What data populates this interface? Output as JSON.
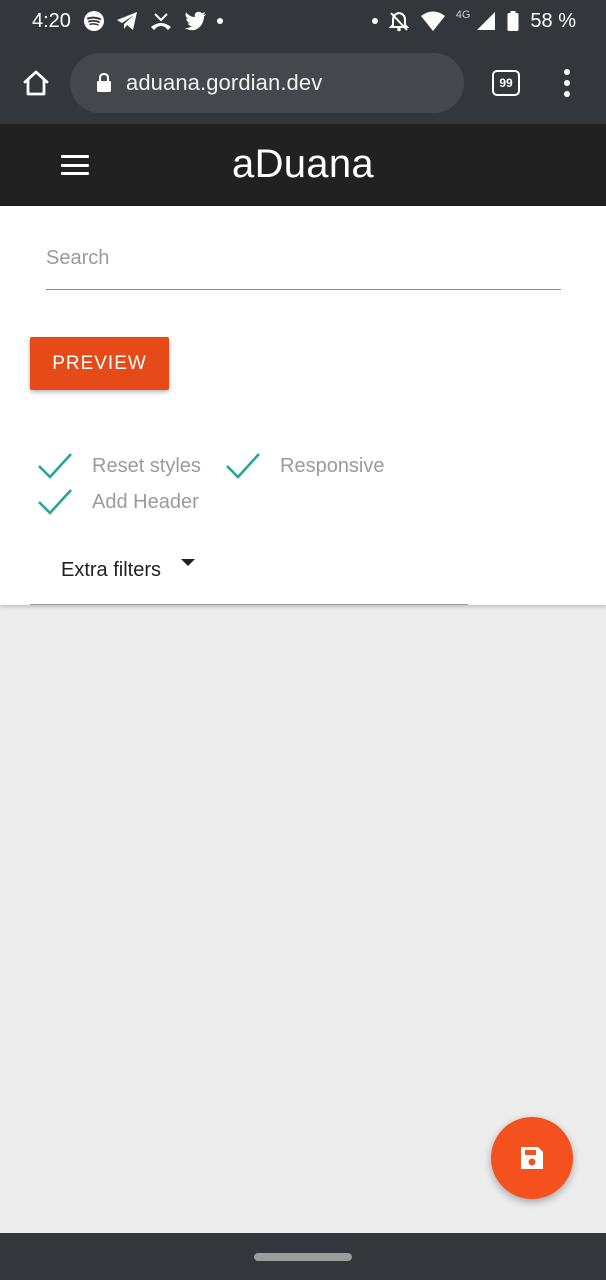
{
  "status_bar": {
    "time": "4:20",
    "left_icons": [
      "spotify-icon",
      "telegram-icon",
      "missed-call-icon",
      "twitter-icon",
      "notification-dot"
    ],
    "right_icons": [
      "notification-dot",
      "alarm-off-icon",
      "wifi-icon",
      "signal-icon",
      "battery-icon"
    ],
    "network": "4G",
    "battery": "58 %"
  },
  "browser": {
    "url": "aduana.gordian.dev",
    "tab_count": "99",
    "home_icon": "home-icon",
    "lock_icon": "lock-icon",
    "menu_icon": "more-vert-icon"
  },
  "app_header": {
    "title": "aDuana",
    "menu_icon": "hamburger-menu-icon"
  },
  "search": {
    "placeholder": "Search",
    "value": ""
  },
  "preview_button": {
    "label": "PREVIEW"
  },
  "options": [
    {
      "label": "Reset styles",
      "checked": true
    },
    {
      "label": "Responsive",
      "checked": true
    },
    {
      "label": "Add Header",
      "checked": true
    }
  ],
  "extra_filters": {
    "label": "Extra filters"
  },
  "fab": {
    "icon": "save-icon"
  },
  "colors": {
    "accent": "#e64a19",
    "fab": "#f4511e",
    "check": "#26a69a",
    "header": "#212121",
    "chrome": "#33363a",
    "background": "#ececec"
  }
}
